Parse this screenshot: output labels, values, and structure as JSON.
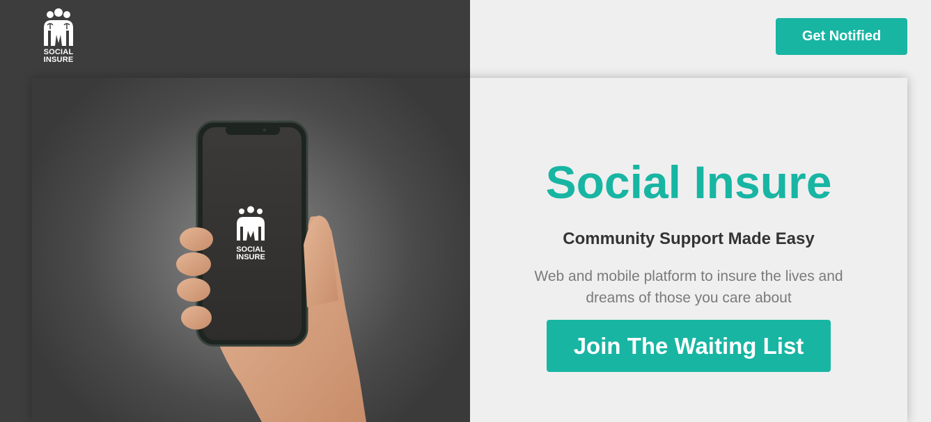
{
  "brand": {
    "logo_line1": "SOCIAL",
    "logo_line2": "INSURE",
    "accent_color": "#18b5a3"
  },
  "header": {
    "notify_button_label": "Get Notified"
  },
  "hero": {
    "title": "Social Insure",
    "subtitle": "Community Support Made Easy",
    "description": "Web and mobile platform to insure the lives and dreams of those you care about",
    "cta_label": "Join The Waiting List",
    "phone_logo_line1": "SOCIAL",
    "phone_logo_line2": "INSURE"
  }
}
